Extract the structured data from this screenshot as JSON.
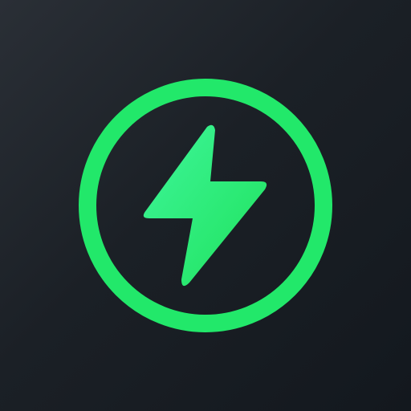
{
  "icon": {
    "name": "lightning-bolt-circle",
    "background_colors": [
      "#2a2f36",
      "#13181e"
    ],
    "ring_color": "#22e86a",
    "bolt_colors": [
      "#3ef59a",
      "#1fe25c"
    ]
  }
}
